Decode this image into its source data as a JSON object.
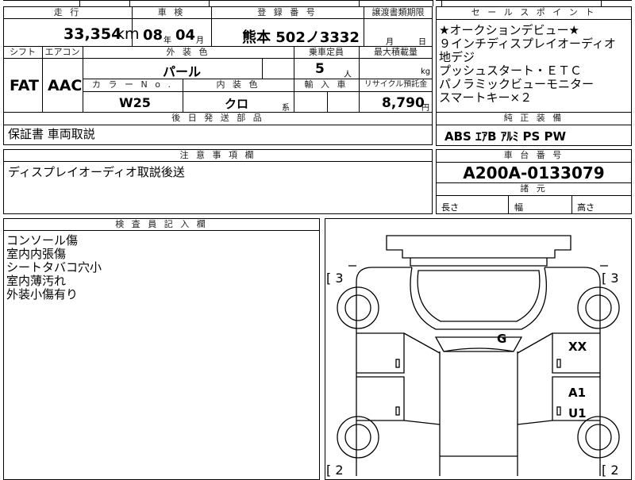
{
  "top_table": {
    "mileage_label": "走 行",
    "mileage_value": "33,354",
    "mileage_unit": "km",
    "inspection_label": "車 検",
    "inspection_year": "08",
    "inspection_year_unit": "年",
    "inspection_month": "04",
    "inspection_month_unit": "月",
    "registration_label": "登 録 番 号",
    "registration_value": "熊本 502ノ3332",
    "transfer_label": "譲渡書類期限",
    "transfer_month_unit": "月",
    "transfer_day_unit": "日",
    "shift_label": "シフト",
    "shift_value": "FAT",
    "aircon_label": "エアコン",
    "aircon_value": "AAC",
    "exterior_color_label": "外 装 色",
    "exterior_color_value": "パール",
    "capacity_label": "乗車定員",
    "capacity_value": "5",
    "capacity_unit": "人",
    "max_load_label": "最大積載量",
    "max_load_unit": "kg",
    "color_no_label": "カ ラ ー N o .",
    "color_no_value": "W25",
    "interior_color_label": "内 装 色",
    "interior_color_value": "クロ",
    "interior_color_unit": "系",
    "import_label": "輸 入 車",
    "recycle_label": "リサイクル預託金",
    "recycle_value": "8,790",
    "recycle_unit": "円",
    "later_parts_label": "後 日 発 送 部 品",
    "later_parts_value": "保証書 車両取説"
  },
  "sales_points": {
    "label": "セ ー ル ス ポ イ ン ト",
    "lines": [
      "★オークションデビュー★",
      "９インチディスプレイオーディオ",
      "地デジ",
      "プッシュスタート・ＥＴＣ",
      "パノラミックビューモニター",
      "スマートキー×２"
    ]
  },
  "genuine_equipment": {
    "label": "純 正 装 備",
    "value": "ABS ｴｱB ｱﾙﾐ PS PW"
  },
  "notes": {
    "label": "注 意 事 項 欄",
    "value": "ディスプレイオーディオ取説後送"
  },
  "chassis": {
    "label": "車 台 番 号",
    "value": "A200A-0133079",
    "dims_label": "諸 元",
    "length_label": "長さ",
    "width_label": "幅",
    "height_label": "高さ"
  },
  "inspector": {
    "label": "検 査 員 記 入 欄",
    "lines": [
      "コンソール傷",
      "室内内張傷",
      "シートタバコ穴小",
      "室内薄汚れ",
      "外装小傷有り"
    ]
  },
  "diagram": {
    "top_left_tag": "[ 3",
    "top_right_tag": "[ 3",
    "bottom_left_tag": "[ 2",
    "bottom_right_tag": "[ 2",
    "mark_windshield": "G",
    "mark_right_front": "XX",
    "mark_right_mid_1": "A1",
    "mark_right_mid_2": "U1"
  }
}
